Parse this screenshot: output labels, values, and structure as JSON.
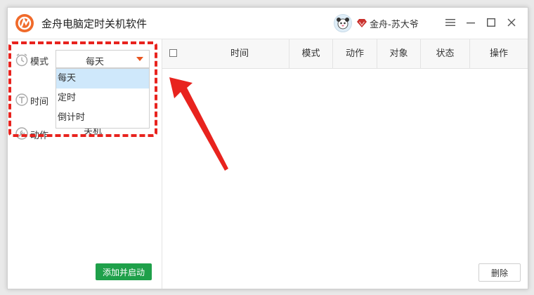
{
  "app": {
    "title": "金舟电脑定时关机软件",
    "username": "金舟-苏大爷"
  },
  "form": {
    "mode_label": "模式",
    "time_label": "时间",
    "action_label": "动作",
    "mode_selected": "每天",
    "action_value": "关机",
    "options": [
      "每天",
      "定时",
      "倒计时"
    ],
    "add_button": "添加并启动"
  },
  "table": {
    "columns": [
      "时间",
      "模式",
      "动作",
      "对象",
      "状态",
      "操作"
    ]
  },
  "footer": {
    "delete_button": "删除"
  },
  "colors": {
    "brand": "#f06a2a",
    "accent_red": "#e8231e",
    "add_button_green": "#1fa04a",
    "selected_option_bg": "#cfe8fb"
  }
}
